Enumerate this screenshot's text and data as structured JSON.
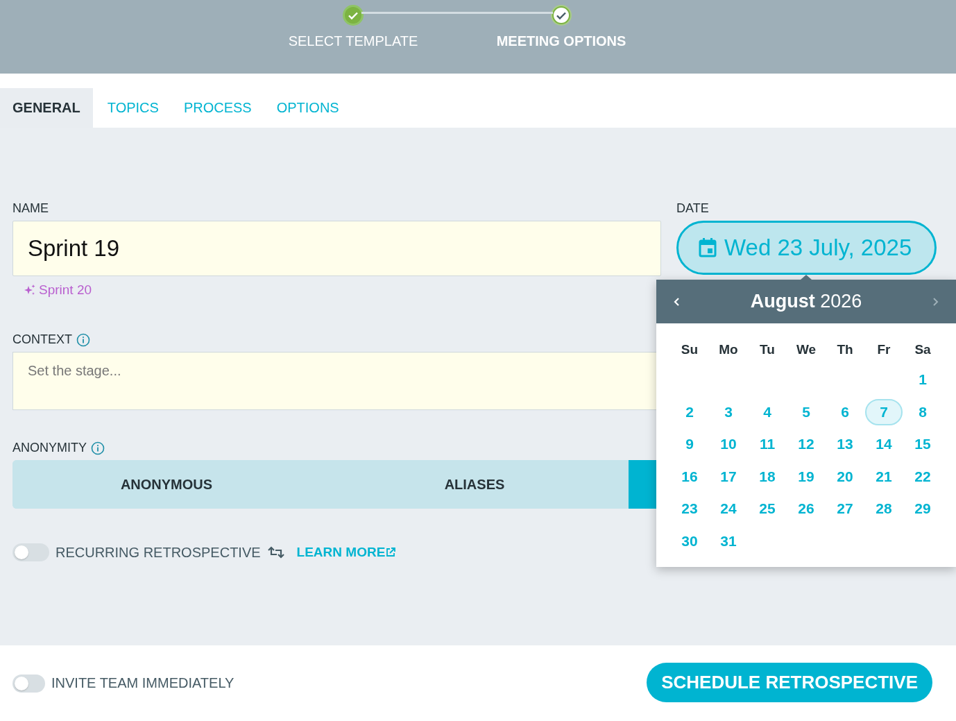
{
  "stepper": {
    "steps": [
      {
        "label": "SELECT TEMPLATE",
        "done": true,
        "selected": false
      },
      {
        "label": "MEETING OPTIONS",
        "done": true,
        "selected": true
      }
    ]
  },
  "tabs": [
    {
      "label": "GENERAL",
      "selected": true
    },
    {
      "label": "TOPICS",
      "selected": false
    },
    {
      "label": "PROCESS",
      "selected": false
    },
    {
      "label": "OPTIONS",
      "selected": false
    }
  ],
  "name": {
    "label": "NAME",
    "value": "Sprint 19",
    "suggestion": "Sprint 20"
  },
  "date": {
    "label": "DATE",
    "value": "Wed 23 July, 2025"
  },
  "context": {
    "label": "CONTEXT",
    "placeholder": "Set the stage..."
  },
  "anonymity": {
    "label": "ANONYMITY",
    "options": [
      {
        "label": "ANONYMOUS",
        "selected": false
      },
      {
        "label": "ALIASES",
        "selected": false
      },
      {
        "selected": true
      }
    ]
  },
  "recurring": {
    "label": "RECURRING RETROSPECTIVE",
    "on": false,
    "link": "LEARN MORE"
  },
  "calendar": {
    "month": "**August** 2026",
    "weekdays": [
      "Su",
      "Mo",
      "Tu",
      "We",
      "Th",
      "Fr",
      "Sa"
    ],
    "weeks": [
      [
        {
          "label": "1",
          "selected": false
        }
      ],
      [
        {
          "label": "2",
          "selected": false
        },
        {
          "label": "3",
          "selected": false
        },
        {
          "label": "4",
          "selected": false
        },
        {
          "label": "5",
          "selected": false
        },
        {
          "label": "6",
          "selected": false
        },
        {
          "label": "7",
          "selected": true
        },
        {
          "label": "8",
          "selected": false
        }
      ],
      [
        {
          "label": "9",
          "selected": false
        },
        {
          "label": "10",
          "selected": false
        },
        {
          "label": "11",
          "selected": false
        },
        {
          "label": "12",
          "selected": false
        },
        {
          "label": "13",
          "selected": false
        },
        {
          "label": "14",
          "selected": false
        },
        {
          "label": "15",
          "selected": false
        }
      ],
      [
        {
          "label": "16",
          "selected": false
        },
        {
          "label": "17",
          "selected": false
        },
        {
          "label": "18",
          "selected": false
        },
        {
          "label": "19",
          "selected": false
        },
        {
          "label": "20",
          "selected": false
        },
        {
          "label": "21",
          "selected": false
        },
        {
          "label": "22",
          "selected": false
        }
      ],
      [
        {
          "label": "23",
          "selected": false
        },
        {
          "label": "24",
          "selected": false
        },
        {
          "label": "25",
          "selected": false
        },
        {
          "label": "26",
          "selected": false
        },
        {
          "label": "27",
          "selected": false
        },
        {
          "label": "28",
          "selected": false
        },
        {
          "label": "29",
          "selected": false
        }
      ],
      [
        {
          "label": "30",
          "selected": false
        },
        {
          "label": "31",
          "selected": false
        }
      ]
    ]
  },
  "footer": {
    "invite": {
      "label": "INVITE TEAM IMMEDIATELY",
      "on": false
    },
    "button": "SCHEDULE RETROSPECTIVE"
  }
}
